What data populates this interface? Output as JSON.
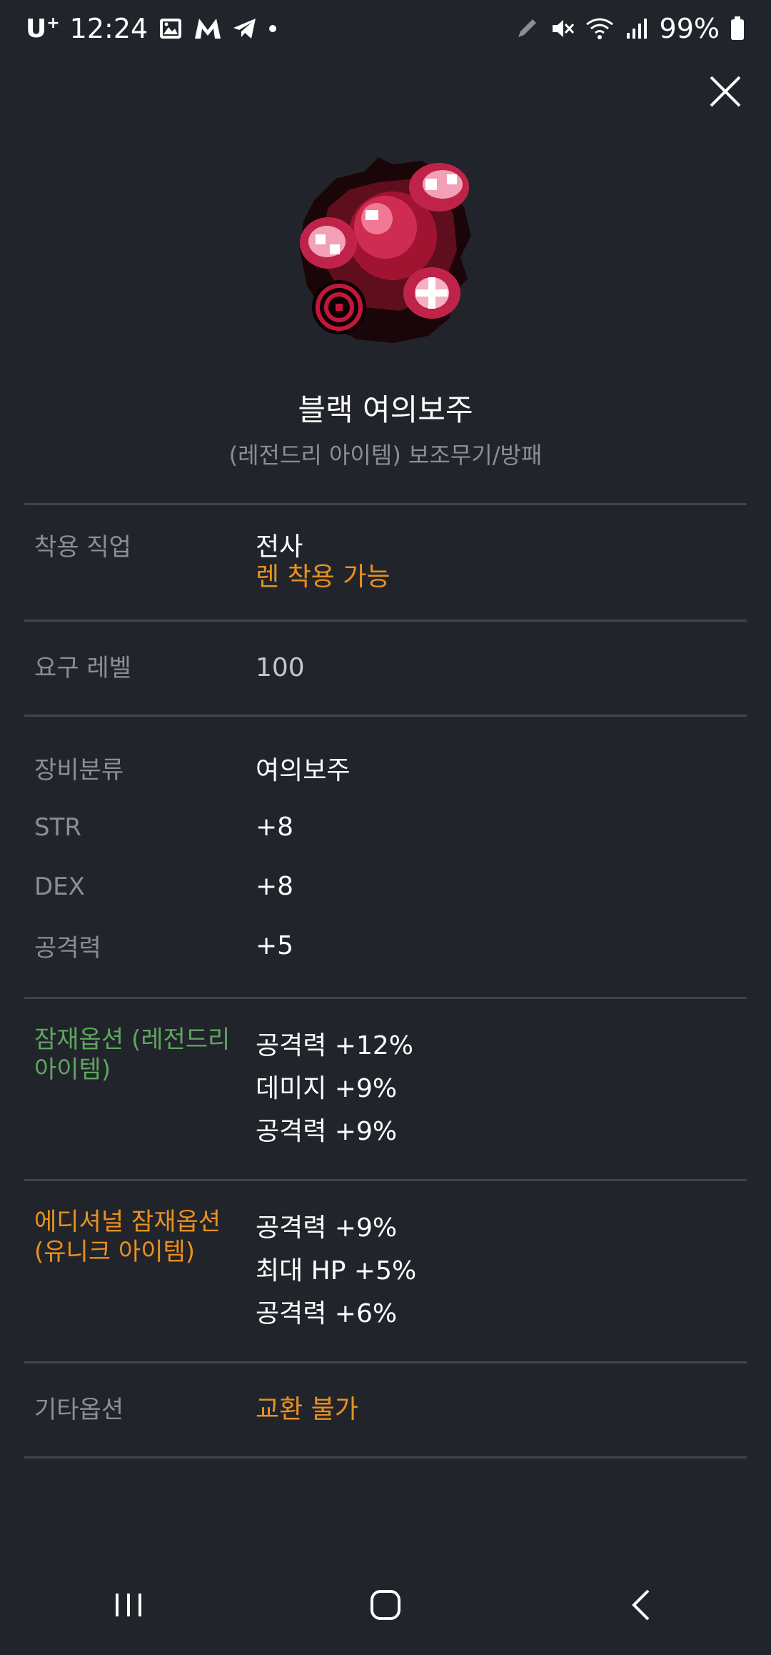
{
  "status_bar": {
    "carrier": "U",
    "carrier_sup": "+",
    "time": "12:24",
    "battery": "99%"
  },
  "item": {
    "name": "블랙 여의보주",
    "subtitle": "(레전드리 아이템) 보조무기/방패"
  },
  "rows": {
    "job": {
      "label": "착용 직업",
      "value": "전사",
      "note": "렌 착용 가능"
    },
    "level": {
      "label": "요구 레벨",
      "value": "100"
    },
    "category": {
      "label": "장비분류",
      "value": "여의보주"
    },
    "str": {
      "label": "STR",
      "value": "+8"
    },
    "dex": {
      "label": "DEX",
      "value": "+8"
    },
    "atk": {
      "label": "공격력",
      "value": "+5"
    },
    "potential": {
      "label_line1": "잠재옵션",
      "label_line2": "(레전드리 아이템)",
      "values": [
        "공격력 +12%",
        "데미지 +9%",
        "공격력 +9%"
      ]
    },
    "additional": {
      "label_line1": "에디셔널 잠재옵션",
      "label_line2": "(유니크 아이템)",
      "values": [
        "공격력 +9%",
        "최대 HP +5%",
        "공격력 +6%"
      ]
    },
    "other": {
      "label": "기타옵션",
      "value": "교환 불가"
    }
  },
  "icons": {
    "close": "close-icon",
    "nav_recent": "recent-apps-icon",
    "nav_home": "home-icon",
    "nav_back": "back-icon"
  },
  "colors": {
    "background": "#22242b",
    "label": "#8b8e96",
    "orange": "#e8911f",
    "green": "#5fa560",
    "divider": "#41444c"
  }
}
